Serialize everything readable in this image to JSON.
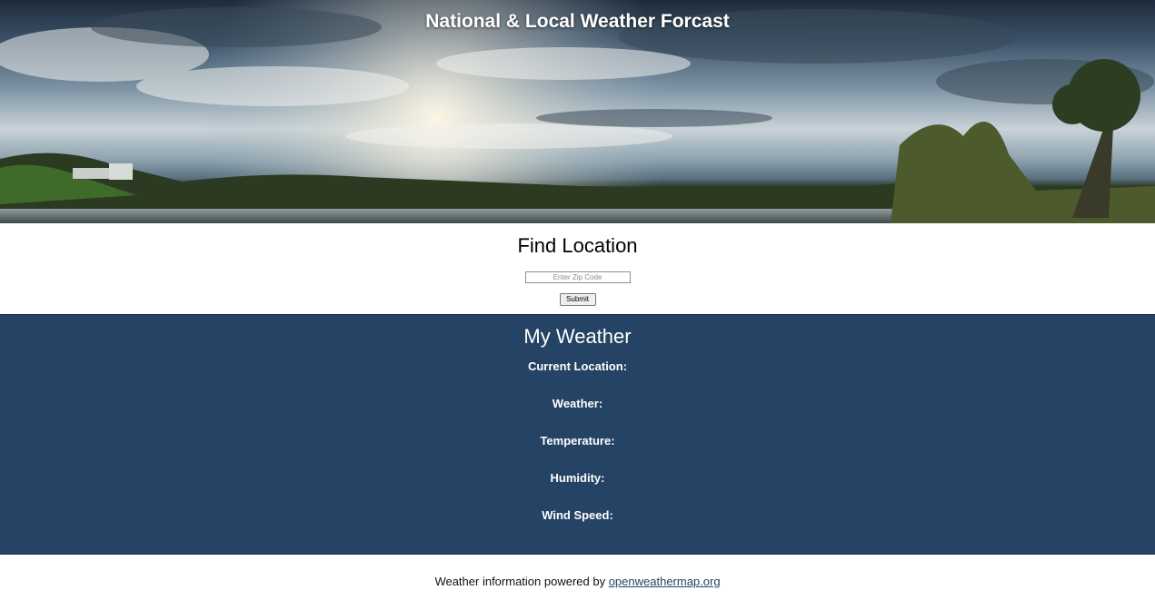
{
  "header": {
    "title": "National & Local Weather Forcast",
    "banner_image": "lake-sunset-landscape"
  },
  "find_location": {
    "title": "Find Location",
    "zip_placeholder": "Enter Zip Code",
    "zip_value": "",
    "submit_label": "Submit"
  },
  "my_weather": {
    "title": "My Weather",
    "current_location_label": "Current Location:",
    "weather_label": "Weather:",
    "temperature_label": "Temperature:",
    "humidity_label": "Humidity:",
    "wind_speed_label": "Wind Speed:",
    "background_color": "#254364"
  },
  "footer": {
    "text": "Weather information powered by",
    "link_text": "openweathermap.org"
  }
}
